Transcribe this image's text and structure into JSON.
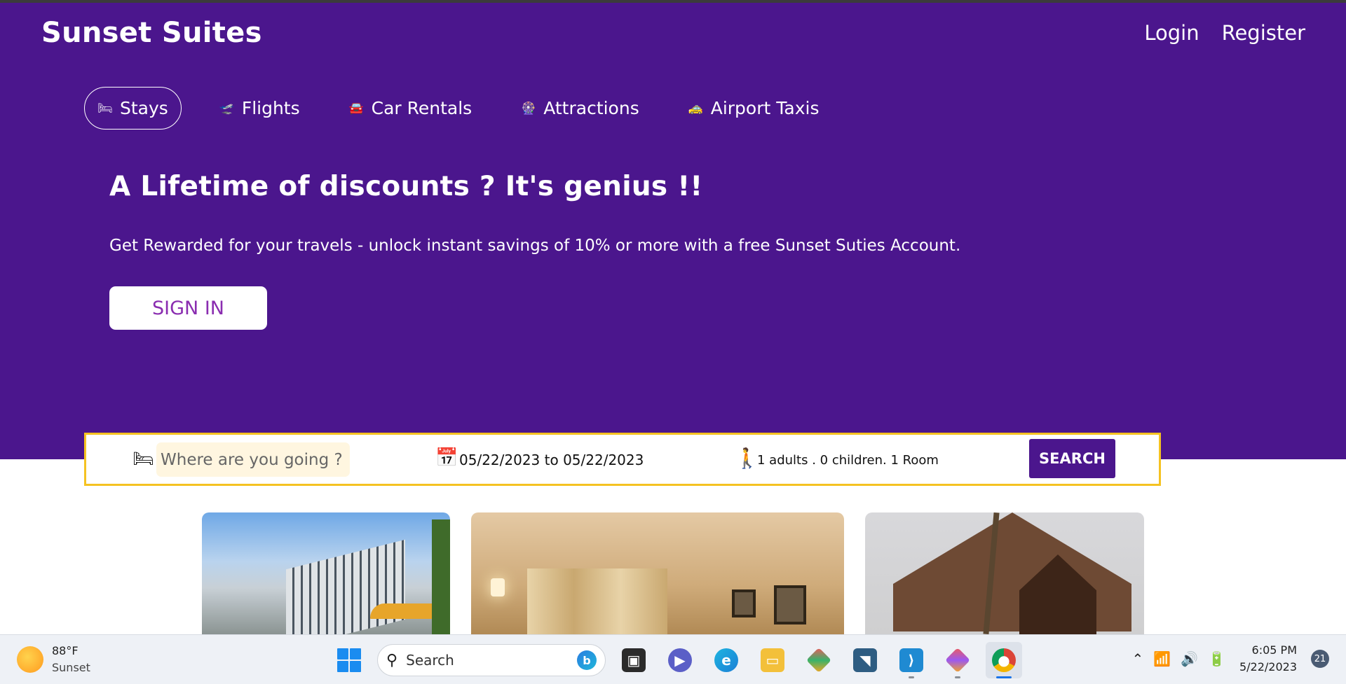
{
  "header": {
    "brand": "Sunset Suites",
    "login": "Login",
    "register": "Register"
  },
  "nav": {
    "items": [
      {
        "label": "Stays",
        "icon": "🛏",
        "active": true
      },
      {
        "label": "Flights",
        "icon": "🛫",
        "active": false
      },
      {
        "label": "Car Rentals",
        "icon": "🚘",
        "active": false
      },
      {
        "label": "Attractions",
        "icon": "🎡",
        "active": false
      },
      {
        "label": "Airport Taxis",
        "icon": "🚕",
        "active": false
      }
    ]
  },
  "hero": {
    "headline": "A Lifetime of discounts ? It's genius !!",
    "subtext": "Get Rewarded for your travels - unlock instant savings of 10% or more with a free Sunset Suties Account.",
    "signin": "SIGN IN"
  },
  "searchbar": {
    "destination_placeholder": "Where are you going ?",
    "dates": "05/22/2023 to 05/22/2023",
    "guests": "1 adults . 0 children. 1 Room",
    "search_button": "SEARCH"
  },
  "taskbar": {
    "weather_temp": "88°F",
    "weather_label": "Sunset",
    "search_label": "Search",
    "time": "6:05 PM",
    "date": "5/22/2023",
    "notifications": "21"
  },
  "colors": {
    "brand_purple": "#4b168d",
    "search_border": "#f5c221",
    "signin_text": "#8a2db0"
  }
}
